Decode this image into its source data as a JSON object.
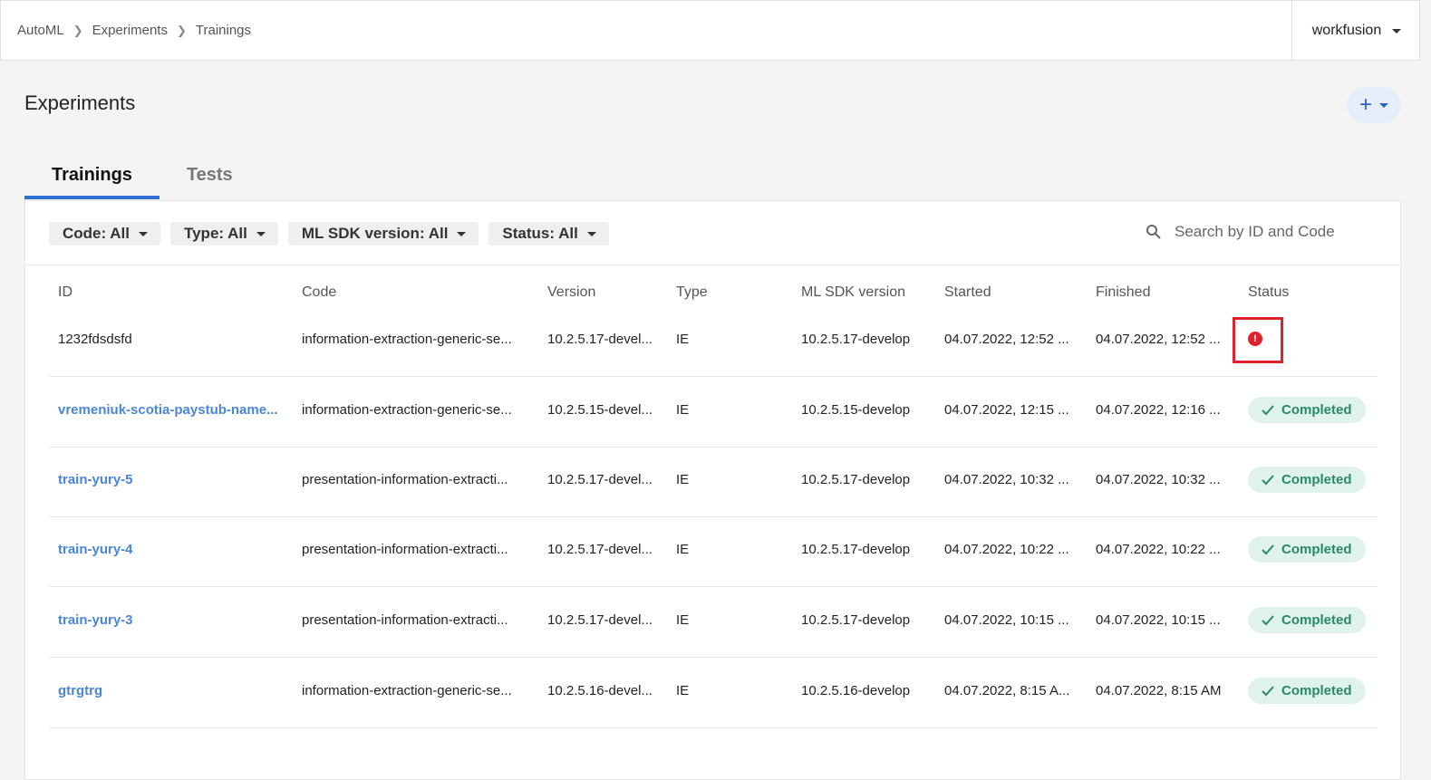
{
  "breadcrumb": [
    "AutoML",
    "Experiments",
    "Trainings"
  ],
  "user": {
    "name": "workfusion"
  },
  "page_title": "Experiments",
  "add_button": {
    "label": "+"
  },
  "tabs": [
    {
      "label": "Trainings",
      "active": true
    },
    {
      "label": "Tests",
      "active": false
    }
  ],
  "filters": [
    {
      "label": "Code: All"
    },
    {
      "label": "Type: All"
    },
    {
      "label": "ML SDK version: All"
    },
    {
      "label": "Status: All"
    }
  ],
  "search": {
    "placeholder": "Search by ID and Code"
  },
  "columns": [
    "ID",
    "Code",
    "Version",
    "Type",
    "ML SDK version",
    "Started",
    "Finished",
    "Status"
  ],
  "rows": [
    {
      "id": "1232fdsdsfd",
      "link": false,
      "code": "information-extraction-generic-se...",
      "version": "10.2.5.17-devel...",
      "type": "IE",
      "sdk": "10.2.5.17-develop",
      "started": "04.07.2022, 12:52 ...",
      "finished": "04.07.2022, 12:52 ...",
      "status": "error",
      "status_label": "!"
    },
    {
      "id": "vremeniuk-scotia-paystub-name...",
      "link": true,
      "code": "information-extraction-generic-se...",
      "version": "10.2.5.15-devel...",
      "type": "IE",
      "sdk": "10.2.5.15-develop",
      "started": "04.07.2022, 12:15 ...",
      "finished": "04.07.2022, 12:16 ...",
      "status": "completed",
      "status_label": "Completed"
    },
    {
      "id": "train-yury-5",
      "link": true,
      "code": "presentation-information-extracti...",
      "version": "10.2.5.17-devel...",
      "type": "IE",
      "sdk": "10.2.5.17-develop",
      "started": "04.07.2022, 10:32 ...",
      "finished": "04.07.2022, 10:32 ...",
      "status": "completed",
      "status_label": "Completed"
    },
    {
      "id": "train-yury-4",
      "link": true,
      "code": "presentation-information-extracti...",
      "version": "10.2.5.17-devel...",
      "type": "IE",
      "sdk": "10.2.5.17-develop",
      "started": "04.07.2022, 10:22 ...",
      "finished": "04.07.2022, 10:22 ...",
      "status": "completed",
      "status_label": "Completed"
    },
    {
      "id": "train-yury-3",
      "link": true,
      "code": "presentation-information-extracti...",
      "version": "10.2.5.17-devel...",
      "type": "IE",
      "sdk": "10.2.5.17-develop",
      "started": "04.07.2022, 10:15 ...",
      "finished": "04.07.2022, 10:15 ...",
      "status": "completed",
      "status_label": "Completed"
    },
    {
      "id": "gtrgtrg",
      "link": true,
      "code": "information-extraction-generic-se...",
      "version": "10.2.5.16-devel...",
      "type": "IE",
      "sdk": "10.2.5.16-develop",
      "started": "04.07.2022, 8:15 A...",
      "finished": "04.07.2022, 8:15 AM",
      "status": "completed",
      "status_label": "Completed"
    }
  ],
  "colors": {
    "accent": "#2f6fd6",
    "link": "#4a86d8",
    "success_bg": "#dff3ec",
    "success_text": "#2a8a66",
    "error": "#e0202a"
  }
}
